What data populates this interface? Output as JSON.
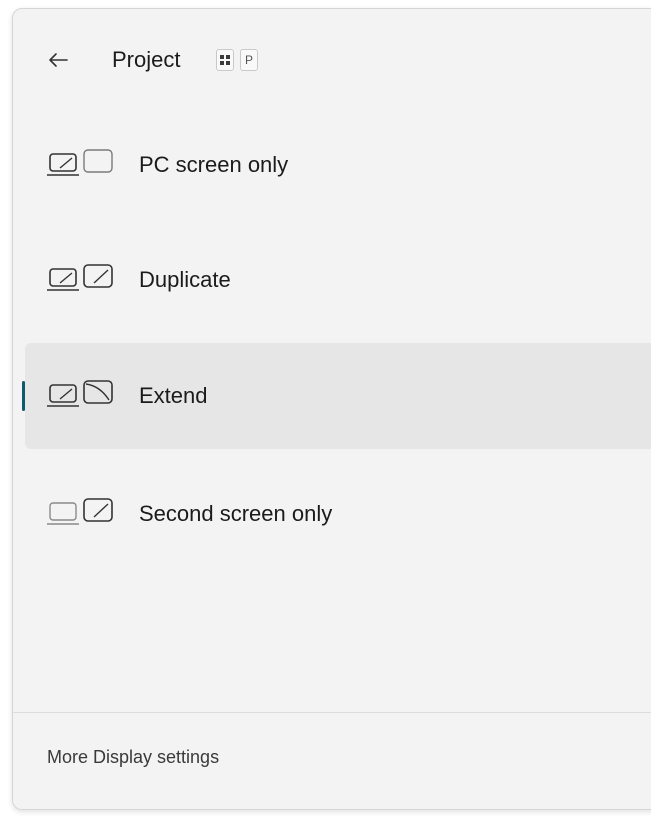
{
  "header": {
    "title": "Project",
    "shortcut_key": "P",
    "back_icon": "back-arrow-icon",
    "win_key_icon": "windows-key-icon"
  },
  "options": [
    {
      "label": "PC screen only",
      "icon": "pc-screen-only-icon",
      "selected": false
    },
    {
      "label": "Duplicate",
      "icon": "duplicate-icon",
      "selected": false
    },
    {
      "label": "Extend",
      "icon": "extend-icon",
      "selected": true
    },
    {
      "label": "Second screen only",
      "icon": "second-screen-only-icon",
      "selected": false
    }
  ],
  "footer": {
    "link_label": "More Display settings"
  },
  "colors": {
    "panel_bg": "#f3f3f3",
    "selected_bg": "#e6e6e6",
    "accent_indicator": "#0f5b6e",
    "text": "#1b1b1b"
  }
}
